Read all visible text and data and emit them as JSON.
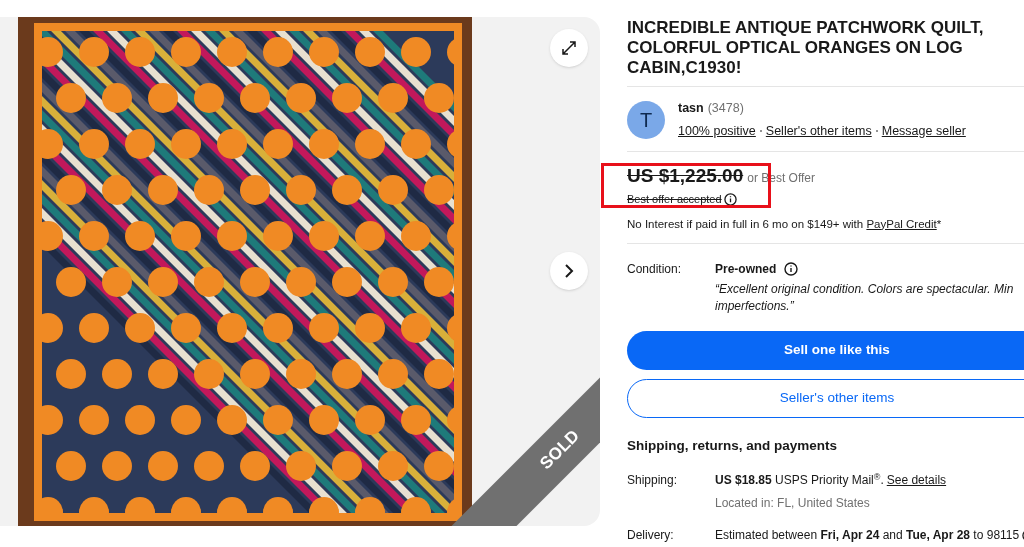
{
  "gallery": {
    "sold_label": "SOLD"
  },
  "title": "INCREDIBLE ANTIQUE PATCHWORK QUILT, COLORFUL OPTICAL ORANGES ON LOG CABIN,C1930!",
  "seller": {
    "initial": "T",
    "name": "tasn",
    "feedback_count": "(3478)",
    "links": [
      "100% positive",
      "Seller's other items",
      "Message seller"
    ]
  },
  "price": {
    "amount": "US $1,225.00",
    "suffix": "or Best Offer",
    "note": "Best offer accepted",
    "struck": true
  },
  "financing": {
    "text": "No Interest if paid in full in 6 mo on $149+ with",
    "link": "PayPal Credit",
    "suffix": "*"
  },
  "condition": {
    "label": "Condition:",
    "value": "Pre-owned",
    "description": "“Excellent original condition. Colors are spectacular. Min\nimperfections.”"
  },
  "buttons": [
    {
      "label": "Sell one like this",
      "kind": "primary"
    },
    {
      "label": "Seller's other items",
      "kind": "secondary"
    }
  ],
  "shipping": {
    "heading": "Shipping, returns, and payments",
    "rows": [
      {
        "label": "Shipping:",
        "value": "**US $18.85** USPS Priority Mail$^{®}$.",
        "link": "See details",
        "sub": "Located in: FL, United States"
      },
      {
        "label": "Delivery:",
        "value": "Estimated between **Fri, Apr 24** and **Tue, Apr 28** to 98115",
        "info": true
      }
    ]
  }
}
